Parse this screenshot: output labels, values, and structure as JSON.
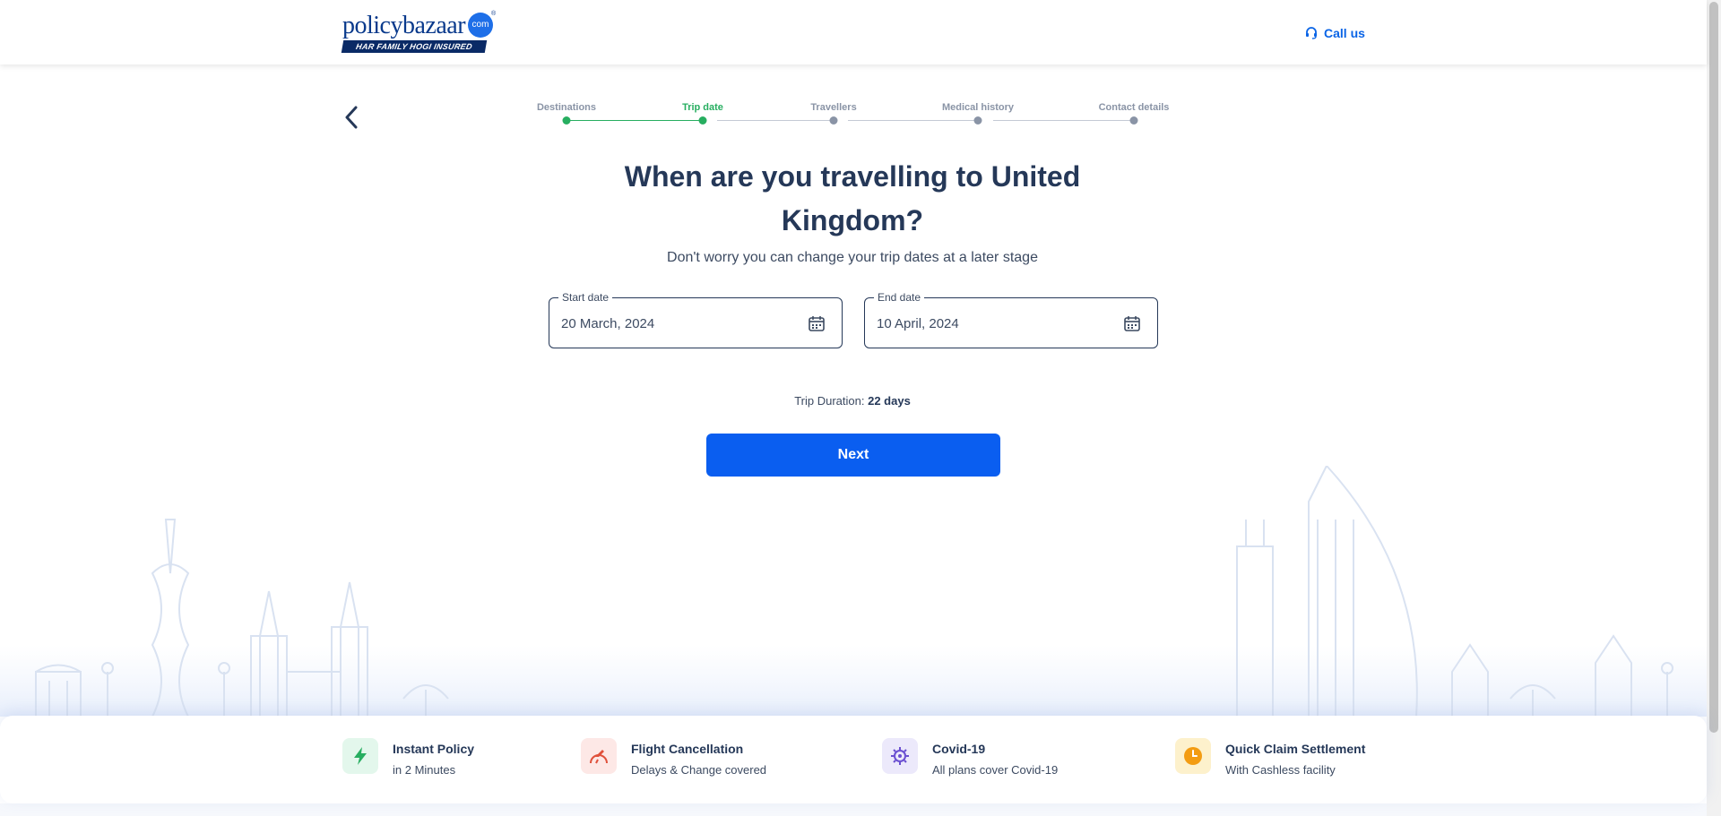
{
  "header": {
    "logo_word_main": "policy",
    "logo_word_second": "bazaar",
    "logo_dot": "com",
    "logo_tm": "®",
    "logo_tagline": "HAR FAMILY HOGI INSURED",
    "call_us_label": "Call us"
  },
  "stepper": {
    "steps": [
      {
        "label": "Destinations",
        "state": "done"
      },
      {
        "label": "Trip date",
        "state": "active"
      },
      {
        "label": "Travellers",
        "state": "pending"
      },
      {
        "label": "Medical history",
        "state": "pending"
      },
      {
        "label": "Contact details",
        "state": "pending"
      }
    ]
  },
  "main": {
    "title": "When are you travelling to United Kingdom?",
    "subtitle": "Don't worry you can change your trip dates at a later stage",
    "start_date": {
      "label": "Start date",
      "value": "20 March, 2024"
    },
    "end_date": {
      "label": "End date",
      "value": "10 April, 2024"
    },
    "duration_label": "Trip Duration:",
    "duration_value": "22 days",
    "next_label": "Next"
  },
  "features": [
    {
      "icon": "lightning-icon",
      "title": "Instant Policy",
      "subtitle": "in 2 Minutes",
      "bg": "#e3f7ec",
      "fg": "#27ae60"
    },
    {
      "icon": "plane-cancel-icon",
      "title": "Flight Cancellation",
      "subtitle": "Delays & Change covered",
      "bg": "#fde8e6",
      "fg": "#e0513b"
    },
    {
      "icon": "virus-icon",
      "title": "Covid-19",
      "subtitle": "All plans cover Covid-19",
      "bg": "#ece9fb",
      "fg": "#6a4fd1"
    },
    {
      "icon": "clock-icon",
      "title": "Quick Claim Settlement",
      "subtitle": "With Cashless facility",
      "bg": "#fdf1cc",
      "fg": "#f39c12"
    }
  ],
  "colors": {
    "primary": "#0a5ef0",
    "active_step": "#27ae60",
    "text_dark": "#253858"
  }
}
